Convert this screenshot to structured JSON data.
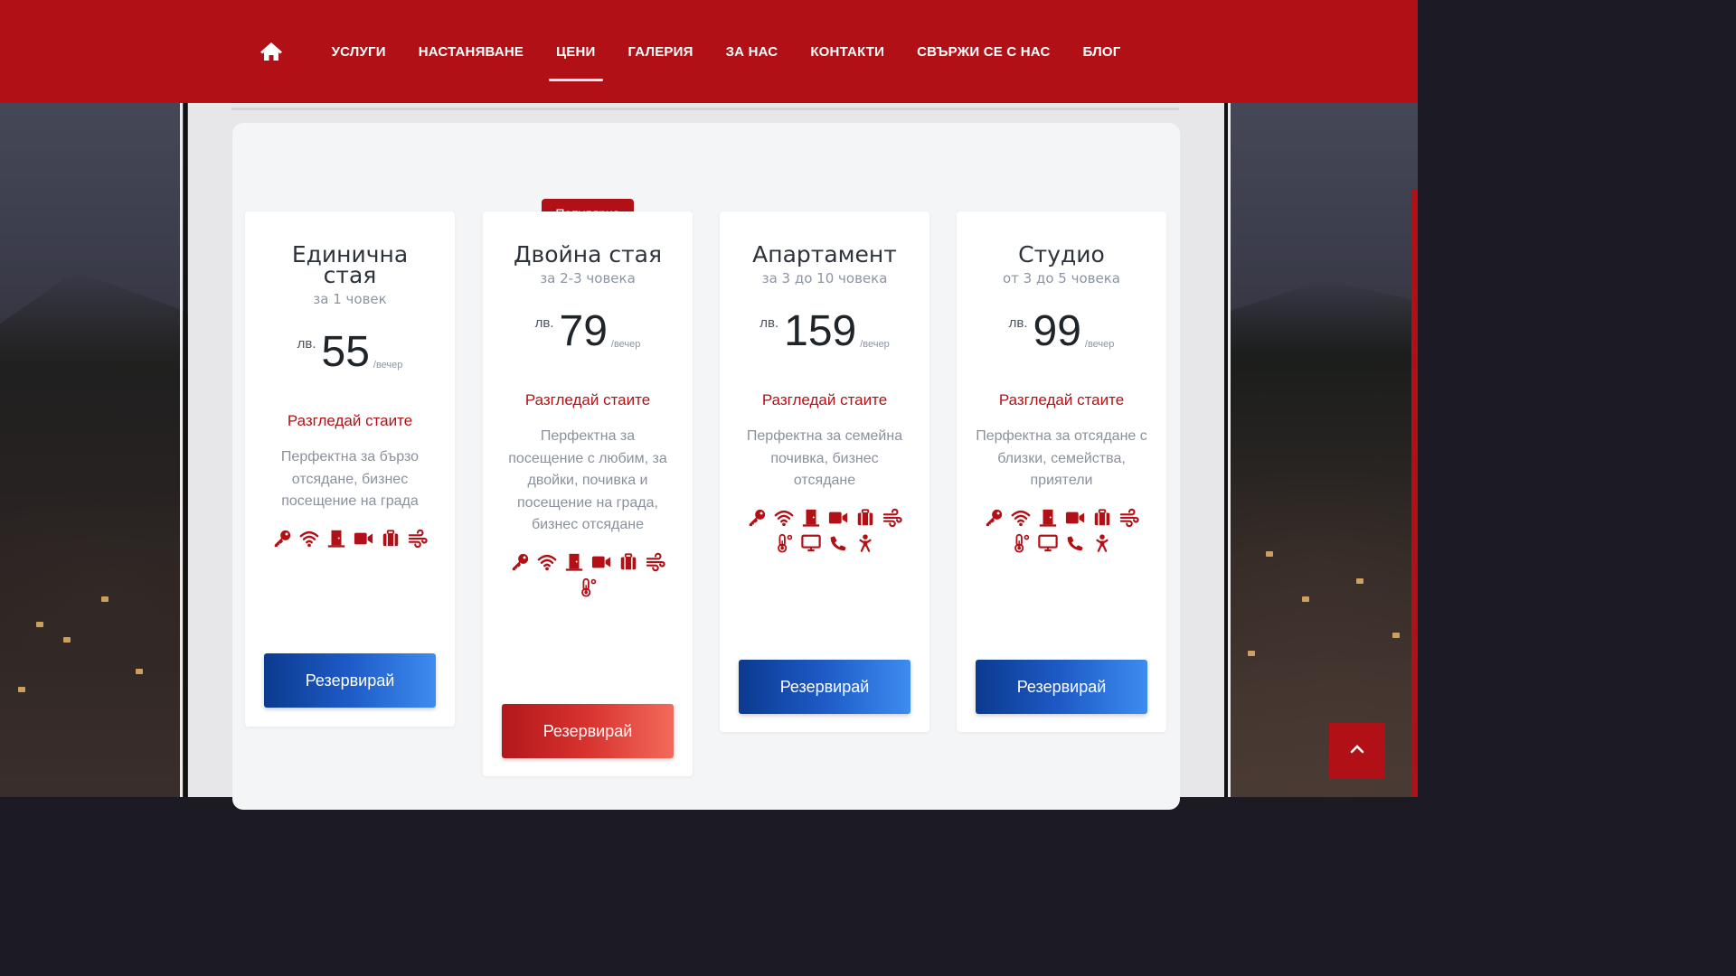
{
  "nav": {
    "home_icon": "home-icon",
    "items": [
      {
        "label": "УСЛУГИ"
      },
      {
        "label": "НАСТАНЯВАНЕ"
      },
      {
        "label": "ЦЕНИ"
      },
      {
        "label": "ГАЛЕРИЯ"
      },
      {
        "label": "ЗА НАС"
      },
      {
        "label": "КОНТАКТИ"
      },
      {
        "label": "СВЪРЖИ СЕ С НАС"
      },
      {
        "label": "БЛОГ"
      }
    ],
    "active": "ЦЕНИ"
  },
  "colors": {
    "brand": "#b11116",
    "accent_blue": "#1e5bc7"
  },
  "badge": "Популярна",
  "cards": [
    {
      "title": "Единична стая",
      "subtitle": "за 1 човек",
      "currency": "лв.",
      "price": "55",
      "per": "/вечер",
      "link": "Разгледай стаите",
      "description": "Перфектна за бързо отсядане, бизнес посещение на града",
      "icons": [
        "key-icon",
        "wifi-icon",
        "door-icon",
        "video-icon",
        "luggage-icon",
        "wind-icon"
      ],
      "button": "Резервирай"
    },
    {
      "title": "Двойна стая",
      "subtitle": "за 2-3 човека",
      "currency": "лв.",
      "price": "79",
      "per": "/вечер",
      "link": "Разгледай стаите",
      "description": "Перфектна за посещение с любим, за двойки, почивка и посещение на града, бизнес отсядане",
      "icons": [
        "key-icon",
        "wifi-icon",
        "door-icon",
        "video-icon",
        "luggage-icon",
        "wind-icon",
        "thermometer-icon"
      ],
      "button": "Резервирай"
    },
    {
      "title": "Апартамент",
      "subtitle": "за 3 до 10 човека",
      "currency": "лв.",
      "price": "159",
      "per": "/вечер",
      "link": "Разгледай стаите",
      "description": "Перфектна за семейна почивка, бизнес отсядане",
      "icons": [
        "key-icon",
        "wifi-icon",
        "door-icon",
        "video-icon",
        "luggage-icon",
        "wind-icon",
        "thermometer-icon",
        "tv-icon",
        "phone-icon",
        "baby-icon"
      ],
      "button": "Резервирай"
    },
    {
      "title": "Студио",
      "subtitle": "от 3 до 5 човека",
      "currency": "лв.",
      "price": "99",
      "per": "/вечер",
      "link": "Разгледай стаите",
      "description": "Перфектна за отсядане с близки, семейства, приятели",
      "icons": [
        "key-icon",
        "wifi-icon",
        "door-icon",
        "video-icon",
        "luggage-icon",
        "wind-icon",
        "thermometer-icon",
        "tv-icon",
        "phone-icon",
        "baby-icon"
      ],
      "button": "Резервирай"
    }
  ],
  "scroll_top_icon": "chevron-up-icon"
}
